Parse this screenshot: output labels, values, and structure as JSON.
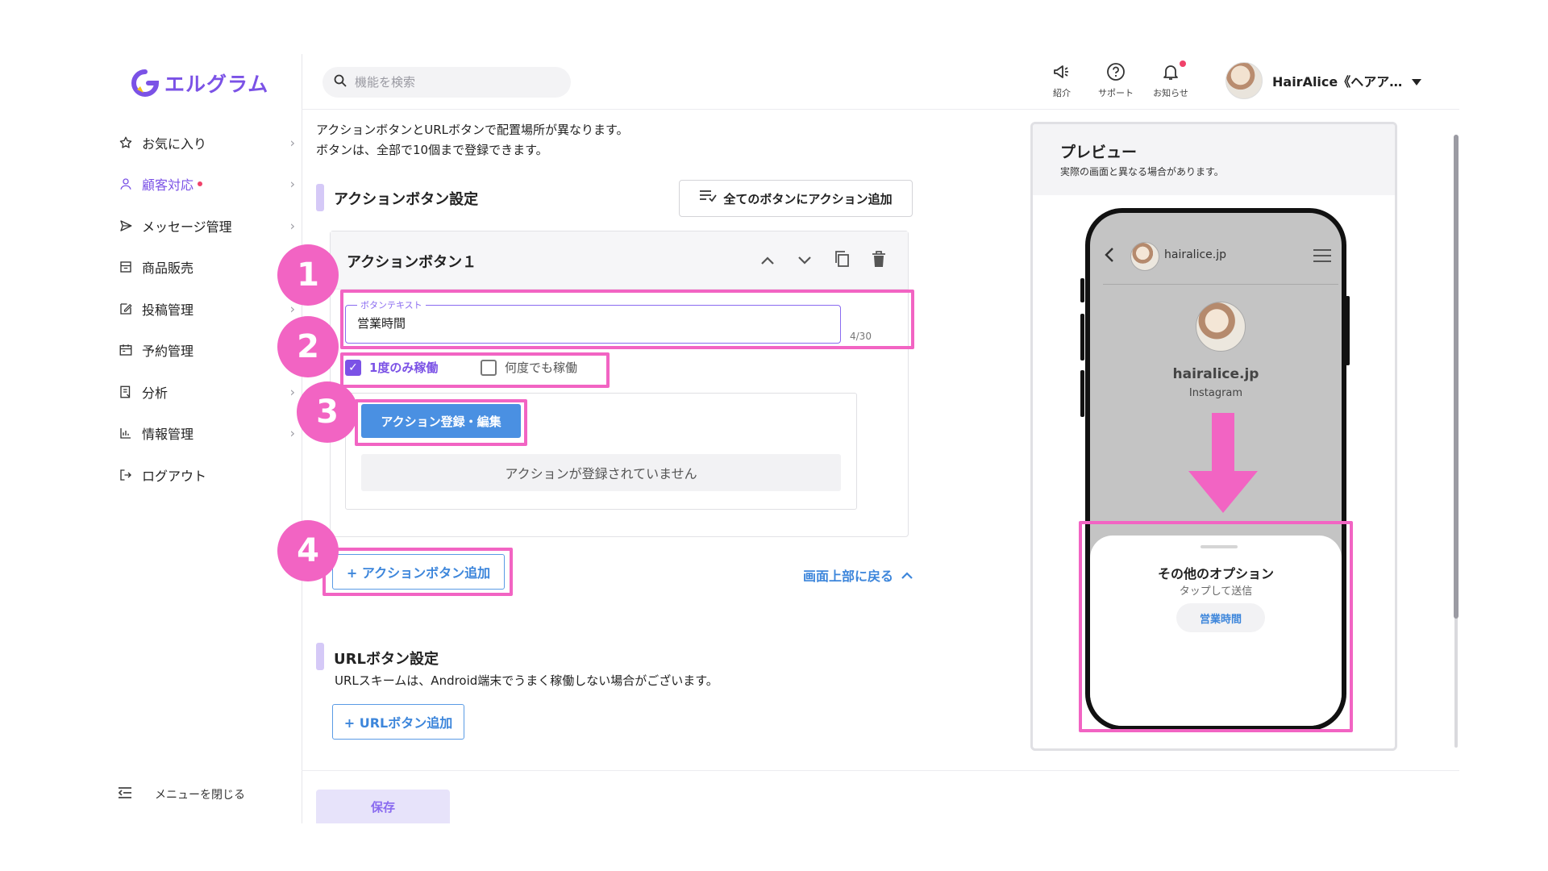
{
  "brand": {
    "name": "エルグラム",
    "color": "#7b52e6"
  },
  "search": {
    "placeholder": "機能を検索"
  },
  "sidebar": {
    "items": [
      {
        "label": "お気に入り",
        "icon": "star-icon",
        "active": false,
        "chevron": true
      },
      {
        "label": "顧客対応",
        "icon": "person-icon",
        "active": true,
        "chevron": true,
        "dot": true
      },
      {
        "label": "メッセージ管理",
        "icon": "send-icon",
        "active": false,
        "chevron": true
      },
      {
        "label": "商品販売",
        "icon": "store-icon",
        "active": false,
        "chevron": false
      },
      {
        "label": "投稿管理",
        "icon": "edit-icon",
        "active": false,
        "chevron": true
      },
      {
        "label": "予約管理",
        "icon": "calendar-icon",
        "active": false,
        "chevron": false
      },
      {
        "label": "分析",
        "icon": "report-icon",
        "active": false,
        "chevron": true
      },
      {
        "label": "情報管理",
        "icon": "chart-icon",
        "active": false,
        "chevron": true
      },
      {
        "label": "ログアウト",
        "icon": "logout-icon",
        "active": false,
        "chevron": false
      }
    ],
    "close_menu_label": "メニューを閉じる"
  },
  "topbar": {
    "intro_label": "紹介",
    "support_label": "サポート",
    "notify_label": "お知らせ",
    "user_name": "HairAlice《ヘアア…"
  },
  "main": {
    "intro_line1": "アクションボタンとURLボタンで配置場所が異なります。",
    "intro_line2": "ボタンは、全部で10個まで登録できます。",
    "action_section_title": "アクションボタン設定",
    "add_action_all_label": "全てのボタンにアクション追加",
    "card_title": "アクションボタン１",
    "field_legend": "ボタンテキスト",
    "field_value": "営業時間",
    "field_counter": "4/30",
    "once_label": "1度のみ稼働",
    "once_checked": true,
    "always_label": "何度でも稼働",
    "always_checked": false,
    "register_action_label": "アクション登録・編集",
    "no_action_text": "アクションが登録されていません",
    "add_action_button_label": "+ アクションボタン追加",
    "back_to_top_label": "画面上部に戻る",
    "url_section_title": "URLボタン設定",
    "url_note": "URLスキームは、Android端末でうまく稼働しない場合がございます。",
    "add_url_button_label": "+ URLボタン追加",
    "save_label": "保存"
  },
  "preview": {
    "title": "プレビュー",
    "subtitle": "実際の画面と異なる場合があります。",
    "handle": "hairalice.jp",
    "profile_name": "hairalice.jp",
    "profile_sub": "Instagram",
    "sheet_title": "その他のオプション",
    "sheet_sub": "タップして送信",
    "chip_label": "営業時間"
  },
  "annotations": {
    "n1": "1",
    "n2": "2",
    "n3": "3",
    "n4": "4",
    "color": "#f264c3"
  }
}
